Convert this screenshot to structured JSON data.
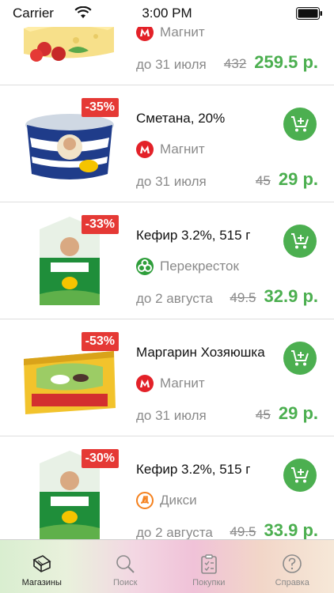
{
  "status_bar": {
    "carrier": "Carrier",
    "time": "3:00 PM"
  },
  "rows": [
    {
      "title": "",
      "discount": "",
      "store": "Магнит",
      "date": "до 31 июля",
      "old_price": "432",
      "new_price": "259.5 р.",
      "image": "cheese-icon",
      "has_cart": false
    },
    {
      "title": "Сметана, 20%",
      "discount": "-35%",
      "store": "Магнит",
      "date": "до 31 июля",
      "old_price": "45",
      "new_price": "29 р.",
      "image": "sour-cream-icon",
      "has_cart": true
    },
    {
      "title": "Кефир 3.2%, 515 г",
      "discount": "-33%",
      "store": "Перекресток",
      "date": "до 2 августа",
      "old_price": "49.5",
      "new_price": "32.9 р.",
      "image": "kefir-icon",
      "has_cart": true
    },
    {
      "title": "Маргарин Хозяюшка",
      "discount": "-53%",
      "store": "Магнит",
      "date": "до 31 июля",
      "old_price": "45",
      "new_price": "29 р.",
      "image": "margarine-icon",
      "has_cart": true
    },
    {
      "title": "Кефир 3.2%, 515 г",
      "discount": "-30%",
      "store": "Дикси",
      "date": "до 2 августа",
      "old_price": "49.5",
      "new_price": "33.9 р.",
      "image": "kefir-icon",
      "has_cart": true
    }
  ],
  "tabs": [
    {
      "label": "Магазины",
      "icon": "shops-icon",
      "active": true
    },
    {
      "label": "Поиск",
      "icon": "search-icon",
      "active": false
    },
    {
      "label": "Покупки",
      "icon": "shopping-list-icon",
      "active": false
    },
    {
      "label": "Справка",
      "icon": "help-icon",
      "active": false
    }
  ],
  "colors": {
    "accent": "#4caf50",
    "discount": "#e53935",
    "magnit": "#e32128",
    "perekrestok": "#2e9e3a",
    "dixi": "#f5821f"
  }
}
